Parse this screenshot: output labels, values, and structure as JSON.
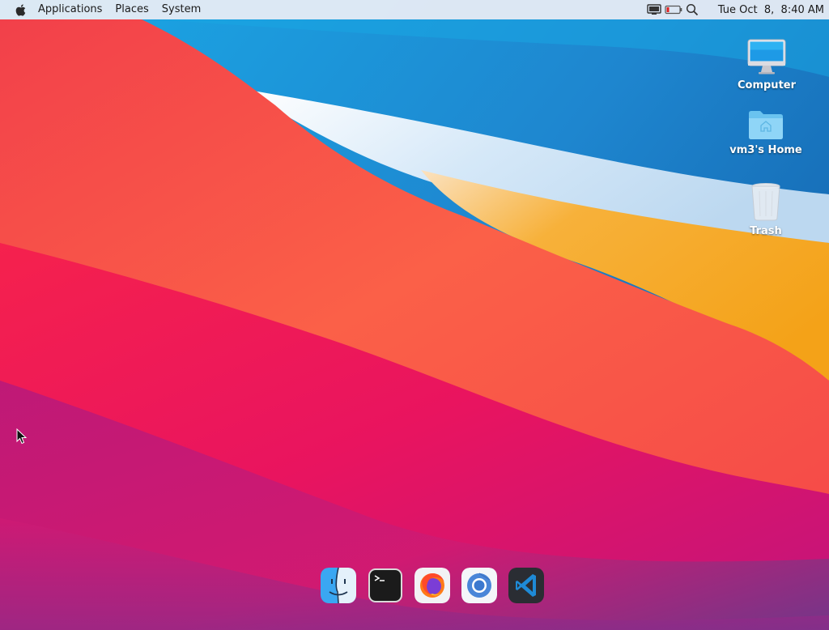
{
  "menubar": {
    "apple_icon": "apple-icon",
    "items": [
      {
        "label": "Applications"
      },
      {
        "label": "Places"
      },
      {
        "label": "System"
      }
    ],
    "tray": {
      "display_icon": "display-icon",
      "battery_icon": "battery-icon",
      "search_icon": "search-icon"
    },
    "clock": "Tue Oct  8,  8:40 AM"
  },
  "desktop_icons": [
    {
      "label": "Computer",
      "icon": "computer-icon"
    },
    {
      "label": "vm3's Home",
      "icon": "home-folder-icon"
    },
    {
      "label": "Trash",
      "icon": "trash-icon"
    }
  ],
  "dock": {
    "items": [
      {
        "icon": "finder-icon"
      },
      {
        "icon": "terminal-icon"
      },
      {
        "icon": "firefox-icon"
      },
      {
        "icon": "chromium-icon"
      },
      {
        "icon": "vscode-icon"
      }
    ]
  },
  "colors": {
    "wallpaper_red": "#f23a4c",
    "wallpaper_blue": "#1e8fd6",
    "wallpaper_orange": "#f7a61c",
    "wallpaper_magenta": "#d9166f",
    "menubar_bg": "#ebeef5"
  }
}
